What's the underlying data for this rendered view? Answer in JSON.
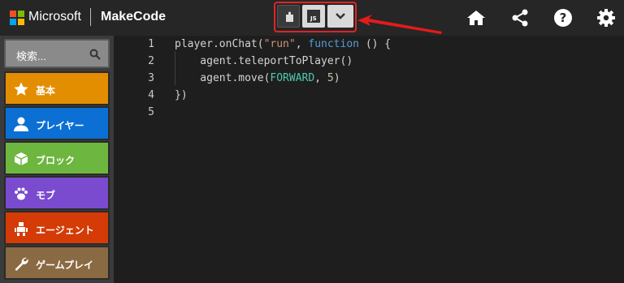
{
  "header": {
    "brand": "Microsoft",
    "product": "MakeCode",
    "toggle": {
      "blocks_icon": "puzzle-icon",
      "js_label": "JS",
      "more_icon": "chevron-down-icon"
    },
    "icons": [
      "home-icon",
      "share-icon",
      "help-icon",
      "gear-icon"
    ]
  },
  "sidebar": {
    "search_placeholder": "検索...",
    "categories": [
      {
        "label": "基本",
        "icon": "star-icon",
        "color": "#e38d00"
      },
      {
        "label": "プレイヤー",
        "icon": "person-icon",
        "color": "#0b6fd3"
      },
      {
        "label": "ブロック",
        "icon": "cube-icon",
        "color": "#6db63f"
      },
      {
        "label": "モブ",
        "icon": "paw-icon",
        "color": "#7a4bcf"
      },
      {
        "label": "エージェント",
        "icon": "robot-icon",
        "color": "#d43b06"
      },
      {
        "label": "ゲームプレイ",
        "icon": "wrench-icon",
        "color": "#8a6a43"
      }
    ]
  },
  "editor": {
    "line_numbers": [
      "1",
      "2",
      "3",
      "4",
      "5"
    ],
    "lines": [
      {
        "a": "player.onChat(",
        "b": "\"run\"",
        "c": ", ",
        "d": "function",
        "e": " () {"
      },
      {
        "a": "    agent.teleportToPlayer()"
      },
      {
        "a": "    agent.move(",
        "b": "FORWARD",
        "c": ", ",
        "d": "5",
        "e": ")"
      },
      {
        "a": "})"
      }
    ]
  },
  "colors": {
    "highlight": "#e02424",
    "topbar": "#262626",
    "editor_bg": "#1e1e1e"
  }
}
